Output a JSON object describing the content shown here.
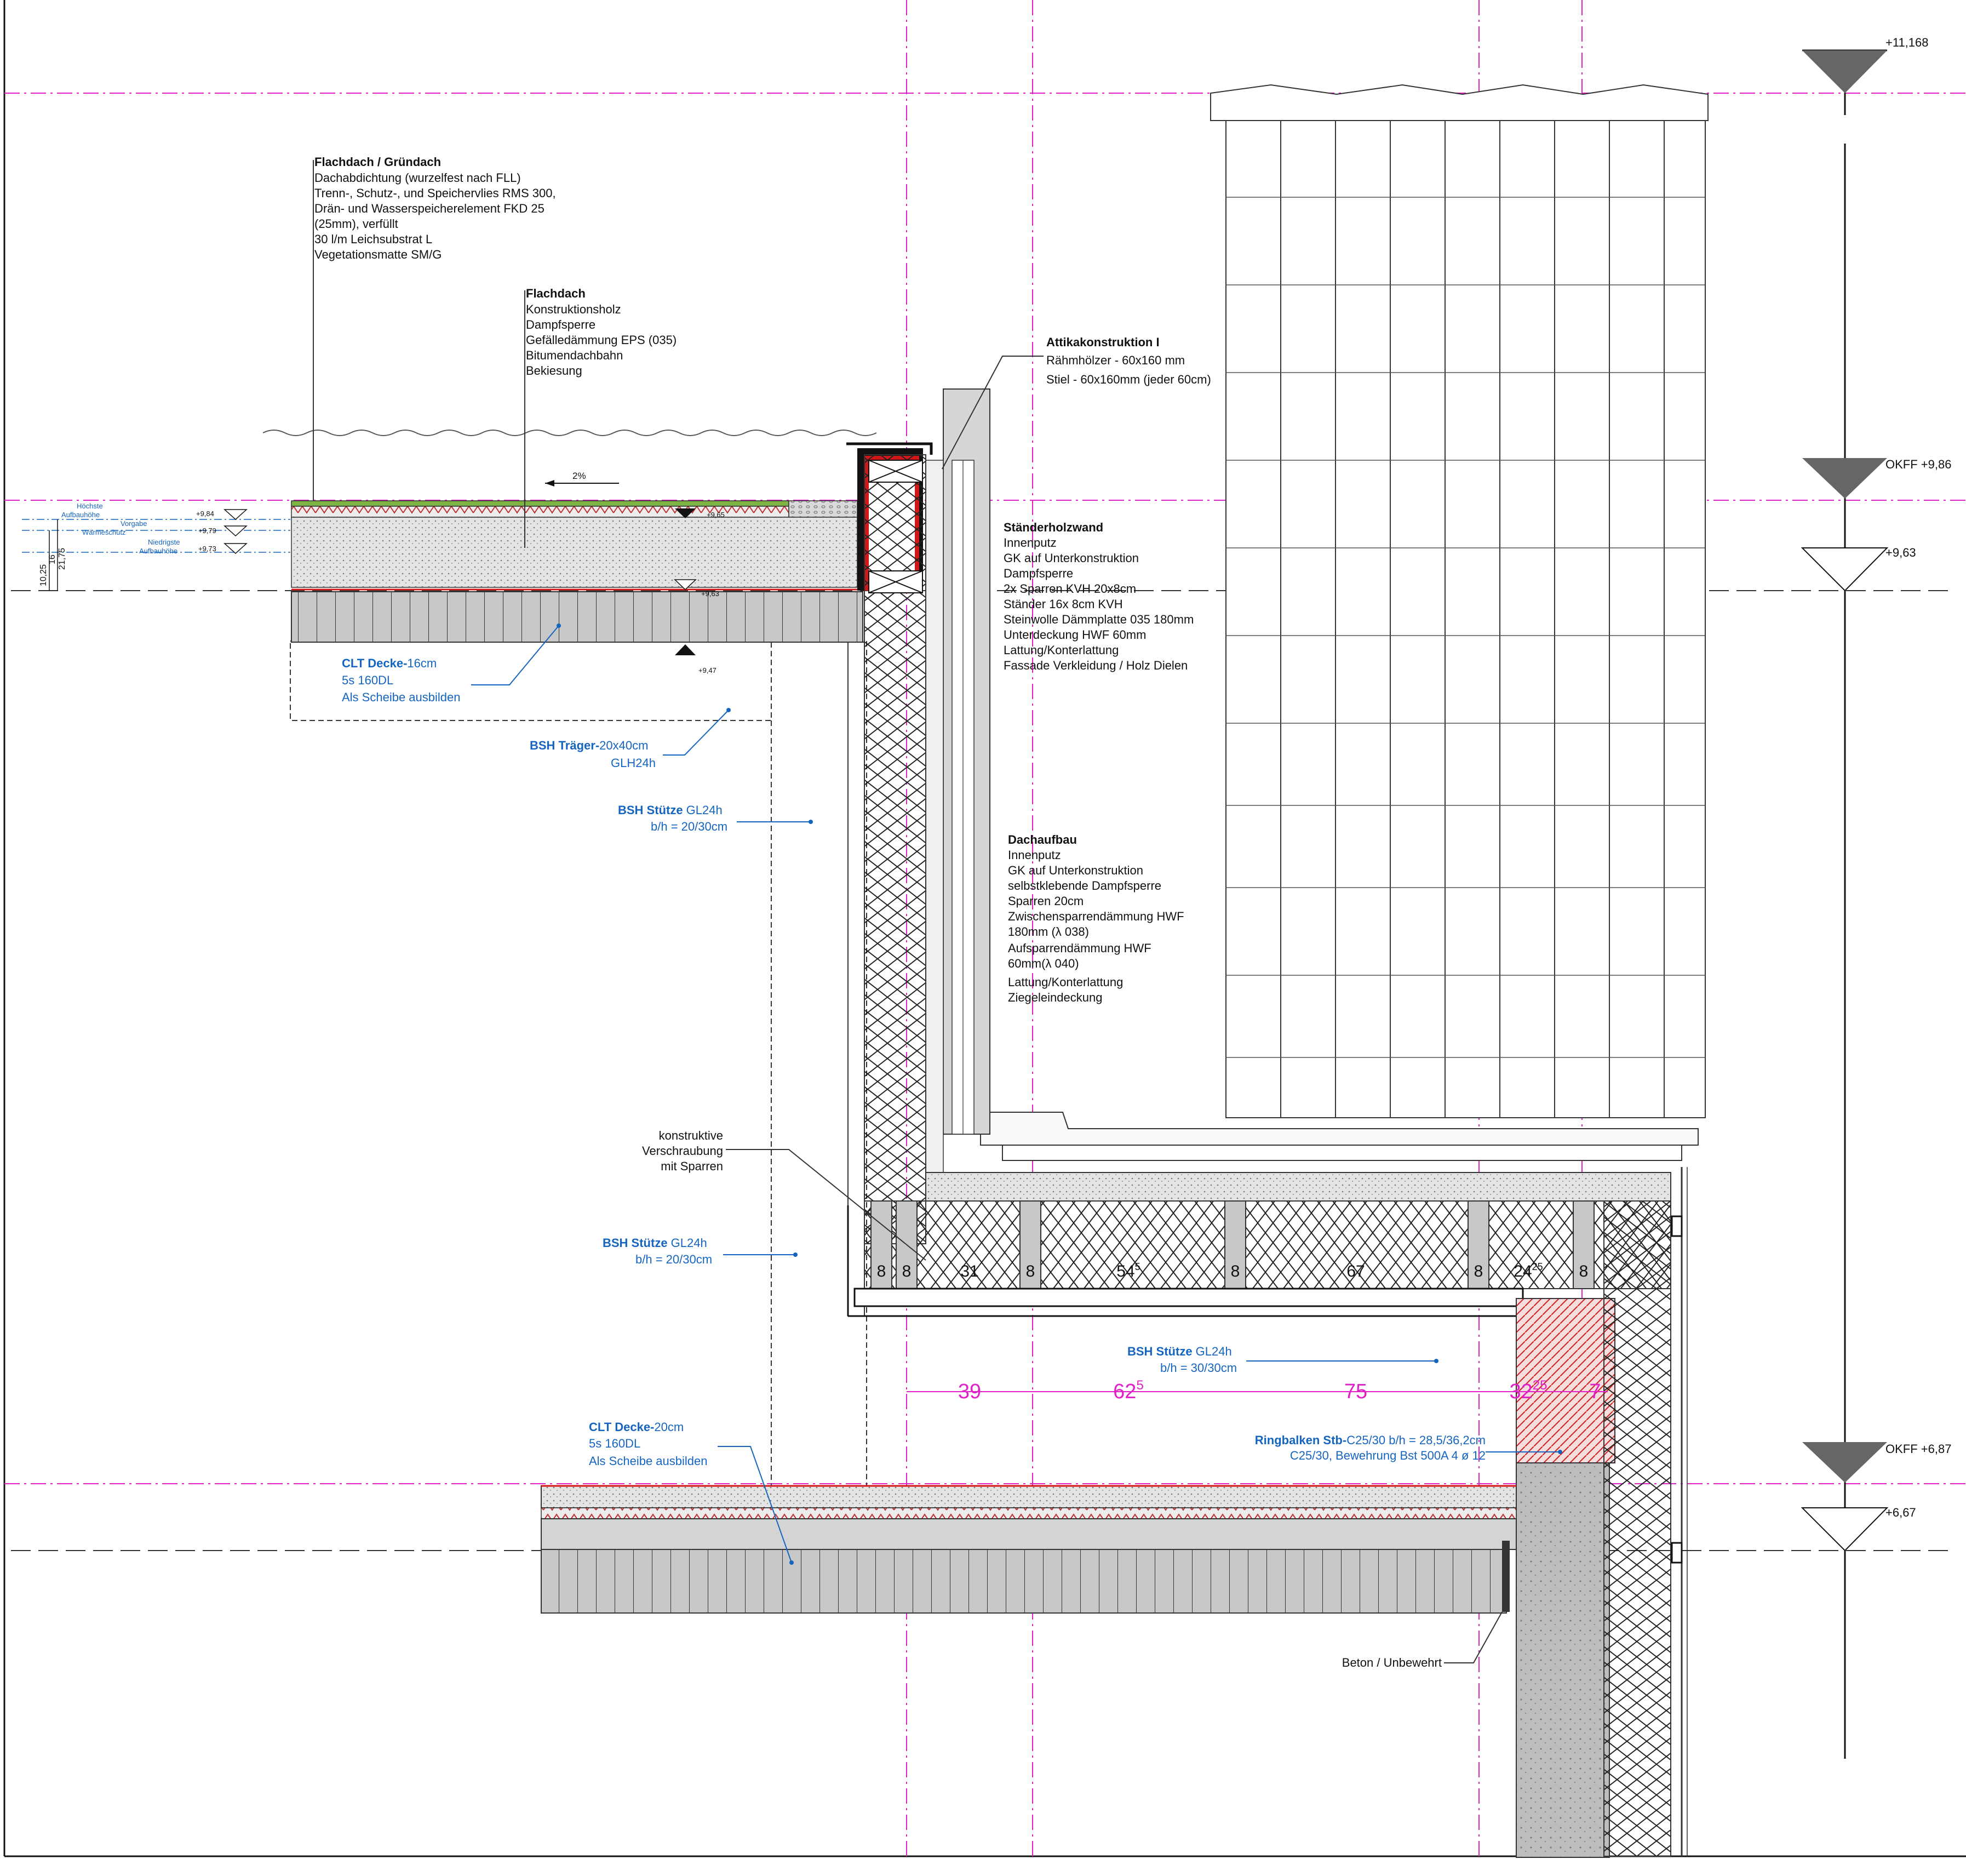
{
  "colors": {
    "magenta": "#e020c8",
    "blue": "#1565c0",
    "red": "#d01818",
    "dark": "#111111",
    "hatch": "#e06060"
  },
  "elevations": [
    {
      "id": "e1",
      "label": "+11,168",
      "symbol": "filled"
    },
    {
      "id": "e2",
      "label": "OKFF +9,86",
      "symbol": "filled"
    },
    {
      "id": "e3",
      "label": "+9,63",
      "symbol": "open"
    },
    {
      "id": "e4",
      "label": "OKFF +6,87",
      "symbol": "filled"
    },
    {
      "id": "e5",
      "label": "+6,67",
      "symbol": "open"
    }
  ],
  "gruendach": {
    "title": "Flachdach / Gründach",
    "lines": [
      "Dachabdichtung (wurzelfest nach FLL)",
      "Trenn-, Schutz-, und Speichervlies RMS 300,",
      "Drän- und Wasserspeicherelement FKD 25",
      "(25mm), verfüllt",
      "30 l/m Leichsubstrat L",
      "Vegetationsmatte SM/G"
    ]
  },
  "flachdach": {
    "title": "Flachdach",
    "lines": [
      "Konstruktionsholz",
      "Dampfsperre",
      "Gefälledämmung EPS (035)",
      "Bitumendachbahn",
      "Bekiesung"
    ]
  },
  "slope": "2%",
  "attika": {
    "title": "Attikakonstruktion I",
    "lines": [
      "Rähmhölzer - 60x160 mm",
      "Stiel - 60x160mm (jeder 60cm)"
    ]
  },
  "staender": {
    "title": "Ständerholzwand",
    "lines": [
      "Innenputz",
      "GK auf Unterkonstruktion",
      "Dampfsperre",
      "2x Sparren KVH 20x8cm",
      "Ständer 16x 8cm KVH",
      "Steinwolle Dämmplatte 035 180mm",
      "Unterdeckung HWF 60mm",
      "Lattung/Konterlattung",
      "Fassade Verkleidung / Holz Dielen"
    ]
  },
  "dachaufbau": {
    "title": "Dachaufbau",
    "lines": [
      "Innenputz",
      "GK auf Unterkonstruktion",
      "selbstklebende Dampfsperre",
      "Sparren 20cm",
      "Zwischensparrendämmung HWF",
      "180mm (λ 038)",
      "Aufsparrendämmung HWF",
      "60mm(λ 040)",
      "",
      "Lattung/Konterlattung",
      "Ziegeleindeckung"
    ]
  },
  "small_levels": {
    "hoechste": "Höchste",
    "aufbauhoehe": "Aufbauhöhe",
    "vorgabe": "Vorgabe",
    "waermeschutz": "Wärmeschutz",
    "niedrigste": "Niedrigste",
    "aufbauhoehe2": "Aufbauhöhe",
    "l1": "+9,84",
    "l2": "+9,79",
    "l3": "+9,73",
    "l4": "+9,65",
    "l5": "+9,63",
    "l6": "+9,47",
    "d1": "10,25",
    "d2": "16",
    "d3": "21,75"
  },
  "clt16": {
    "title": "CLT Decke-",
    "title2": "16cm",
    "l2": "5s 160DL",
    "l3": "Als Scheibe ausbilden"
  },
  "bsh_traeger": {
    "title": "BSH Träger-",
    "title2": "20x40cm",
    "l2": "GLH24h"
  },
  "bsh_stuetze1": {
    "title": "BSH Stütze",
    "title2": " GL24h",
    "l2": "b/h = 20/30cm"
  },
  "bsh_stuetze2": {
    "title": "BSH Stütze",
    "title2": " GL24h",
    "l2": "b/h = 20/30cm"
  },
  "bsh_stuetze3": {
    "title": "BSH Stütze",
    "title2": " GL24h",
    "l2": "b/h = 30/30cm"
  },
  "verschraubung": {
    "lines": [
      "konstruktive",
      "Verschraubung",
      "mit Sparren"
    ]
  },
  "rafter_dims": [
    "8",
    "8",
    "31",
    "8",
    "54",
    "8",
    "67",
    "8",
    "24",
    "8"
  ],
  "rafter_sup": {
    "d5": "5",
    "d9": "25"
  },
  "mag_dims": [
    "39",
    "62",
    "75",
    "32",
    "7"
  ],
  "mag_sup": {
    "d2": "5",
    "d4": "25"
  },
  "clt20": {
    "title": "CLT Decke-",
    "title2": "20cm",
    "l2": "5s 160DL",
    "l3": "Als Scheibe ausbilden"
  },
  "ringbalken": {
    "title": "Ringbalken Stb-",
    "title2": "C25/30 b/h = 28,5/36,2cm",
    "l2": "C25/30, Bewehrung Bst 500A 4 ø 12"
  },
  "beton": "Beton / Unbewehrt"
}
